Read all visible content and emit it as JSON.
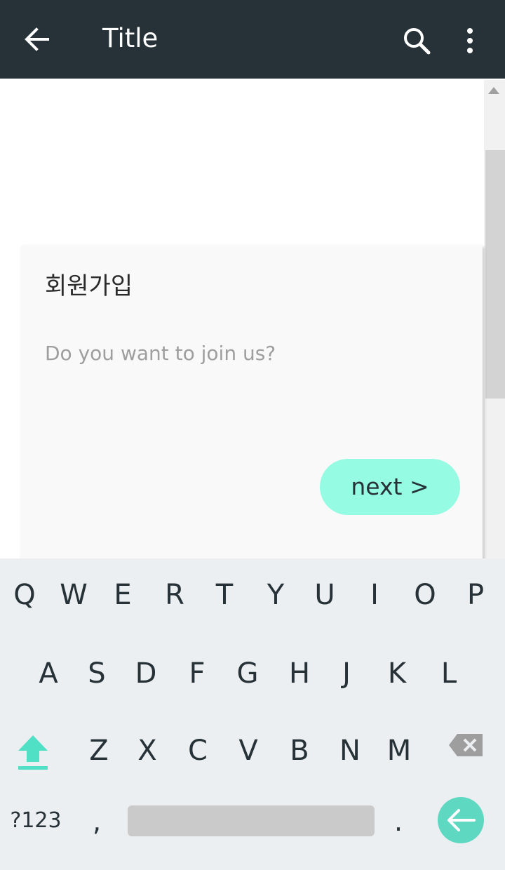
{
  "appbar": {
    "title": "Title",
    "background": "#263238"
  },
  "card": {
    "heading": "회원가입",
    "subtitle": "Do you want to join us?",
    "next_label": "next >"
  },
  "keyboard": {
    "row1": [
      "Q",
      "W",
      "E",
      "R",
      "T",
      "Y",
      "U",
      "I",
      "O",
      "P"
    ],
    "row2": [
      "A",
      "S",
      "D",
      "F",
      "G",
      "H",
      "J",
      "K",
      "L"
    ],
    "row3": [
      "Z",
      "X",
      "C",
      "V",
      "B",
      "N",
      "M"
    ],
    "symbols_label": "?123",
    "comma": ",",
    "period": "."
  },
  "colors": {
    "accent": "#95fbe2",
    "enter": "#5fd8c1",
    "keyboard_bg": "#eceff1",
    "shift": "#4fe0c6"
  },
  "icons": {
    "back": "arrow-back-icon",
    "search": "search-icon",
    "more": "more-vert-icon",
    "shift": "shift-icon",
    "backspace": "backspace-icon",
    "enter": "enter-arrow-icon"
  }
}
